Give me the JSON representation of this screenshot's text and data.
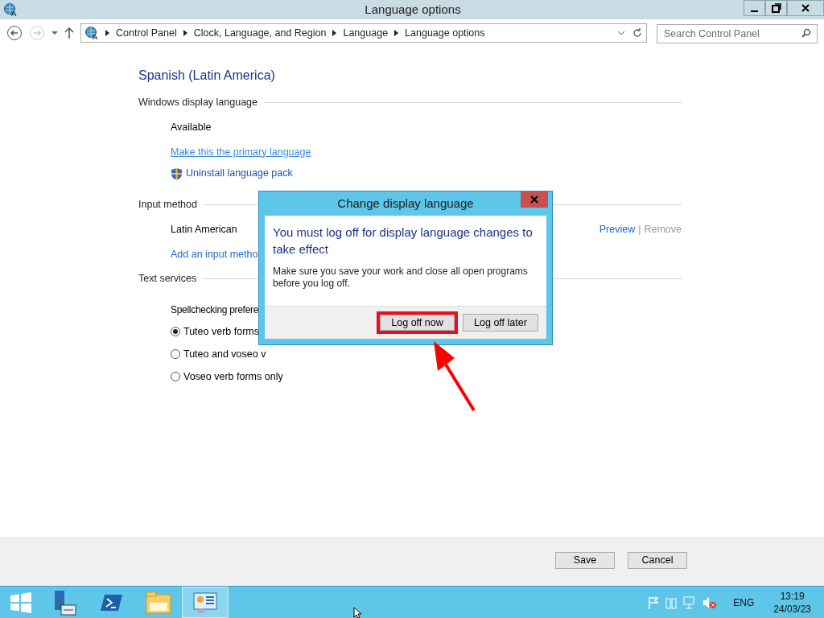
{
  "window": {
    "title": "Language options"
  },
  "breadcrumbs": [
    "Control Panel",
    "Clock, Language, and Region",
    "Language",
    "Language options"
  ],
  "search": {
    "placeholder": "Search Control Panel"
  },
  "page_title": "Spanish (Latin America)",
  "display_language": {
    "heading": "Windows display language",
    "status": "Available",
    "primary_link": "Make this the primary language",
    "uninstall_link": "Uninstall language pack"
  },
  "input_method": {
    "heading": "Input method",
    "name": "Latin American",
    "preview": "Preview",
    "separator": "|",
    "remove": "Remove",
    "add_link": "Add an input metho"
  },
  "text_services": {
    "heading": "Text services",
    "label": "Spellchecking prefere",
    "options": [
      {
        "label": "Tuteo verb forms",
        "selected": true
      },
      {
        "label": "Tuteo and voseo v",
        "selected": false
      },
      {
        "label": "Voseo verb forms only",
        "selected": false
      }
    ]
  },
  "footer_buttons": [
    "Save",
    "Cancel"
  ],
  "dialog": {
    "title": "Change display language",
    "heading": "You must log off for display language changes to take effect",
    "message": "Make sure you save your work and close all open programs before you log off.",
    "buttons": [
      {
        "label": "Log off now",
        "highlighted": true
      },
      {
        "label": "Log off later",
        "highlighted": false
      }
    ]
  },
  "taskbar": {
    "apps": [
      {
        "kind": "server",
        "selected": false
      },
      {
        "kind": "powershell",
        "selected": false
      },
      {
        "kind": "explorer",
        "selected": false
      },
      {
        "kind": "control",
        "selected": true
      }
    ],
    "language": "ENG",
    "time": "13:19",
    "date": "24/03/23"
  }
}
